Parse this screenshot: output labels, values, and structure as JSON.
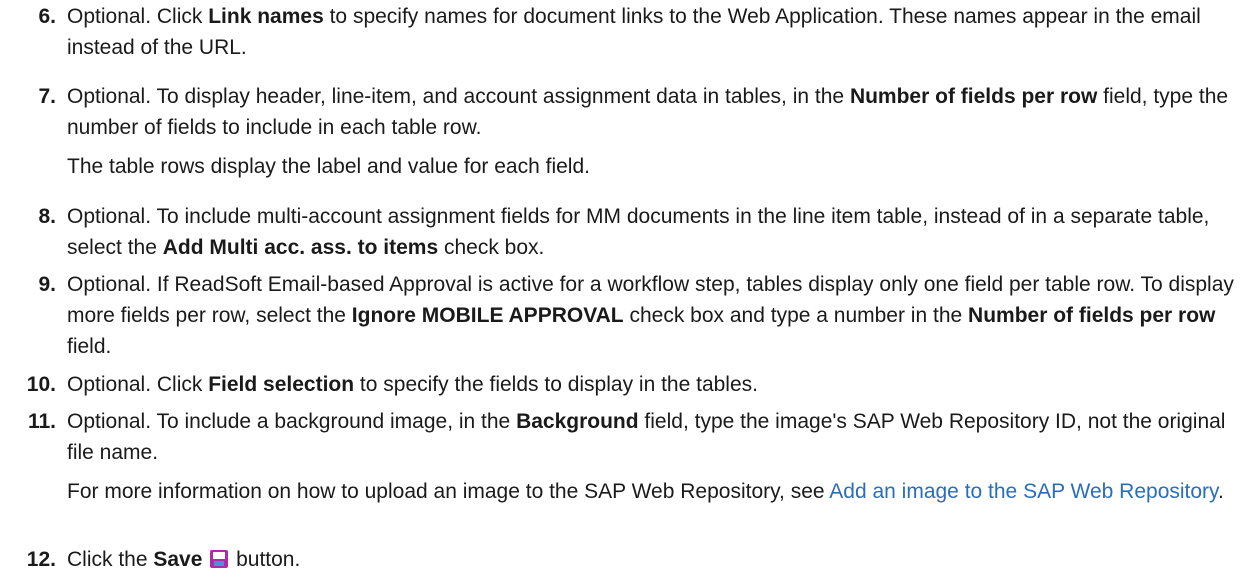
{
  "steps": [
    {
      "number": "6.",
      "parts": [
        "Optional. Click ",
        "Link names",
        " to specify names for document links to the Web Application. These names appear in the email instead of the URL."
      ]
    },
    {
      "number": "7.",
      "parts": [
        "Optional. To display header, line-item, and account assignment data in tables, in the ",
        "Number of fields per row",
        " field, type the number of fields to include in each table row."
      ],
      "note": "The table rows display the label and value for each field."
    },
    {
      "number": "8.",
      "parts": [
        "Optional. To include multi-account assignment fields for MM documents in the line item table, instead of in a separate table, select the ",
        "Add Multi acc. ass. to items",
        " check box."
      ]
    },
    {
      "number": "9.",
      "parts": [
        "Optional. If ReadSoft Email-based Approval is active for a workflow step, tables display only one field per table row. To display more fields per row, select the ",
        "Ignore MOBILE APPROVAL",
        " check box and type a number in the ",
        "Number of fields per row",
        " field."
      ]
    },
    {
      "number": "10.",
      "parts": [
        "Optional. Click ",
        "Field selection",
        " to specify the fields to display in the tables."
      ]
    },
    {
      "number": "11.",
      "parts": [
        "Optional. To include a background image, in the ",
        "Background",
        " field, type the image's SAP Web Repository ID, not the original file name."
      ],
      "note_parts": [
        " For more information on how to upload an image to the SAP Web Repository, see ",
        "Add an image to the SAP Web Repository",
        "."
      ]
    },
    {
      "number": "12.",
      "parts": [
        "Click the ",
        "Save",
        " button."
      ],
      "icon": "save-icon"
    }
  ],
  "colors": {
    "text": "#1a1a1a",
    "link": "#2a6ebb"
  }
}
